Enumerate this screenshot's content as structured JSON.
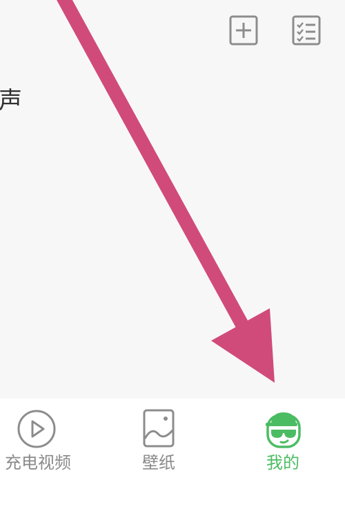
{
  "header": {
    "add_icon": "plus-square-icon",
    "list_icon": "checklist-icon"
  },
  "content": {
    "partial_heading": "声"
  },
  "tabbar": {
    "tabs": [
      {
        "label": "充电视频",
        "icon": "play-circle-icon",
        "active": false
      },
      {
        "label": "壁纸",
        "icon": "image-icon",
        "active": false
      },
      {
        "label": "我的",
        "icon": "avatar-sunglasses-icon",
        "active": true
      }
    ]
  },
  "colors": {
    "active_tab": "#4cbc63",
    "inactive_tab": "#8a8a8a",
    "arrow": "#d04b7a",
    "background": "#f8f7f8"
  }
}
